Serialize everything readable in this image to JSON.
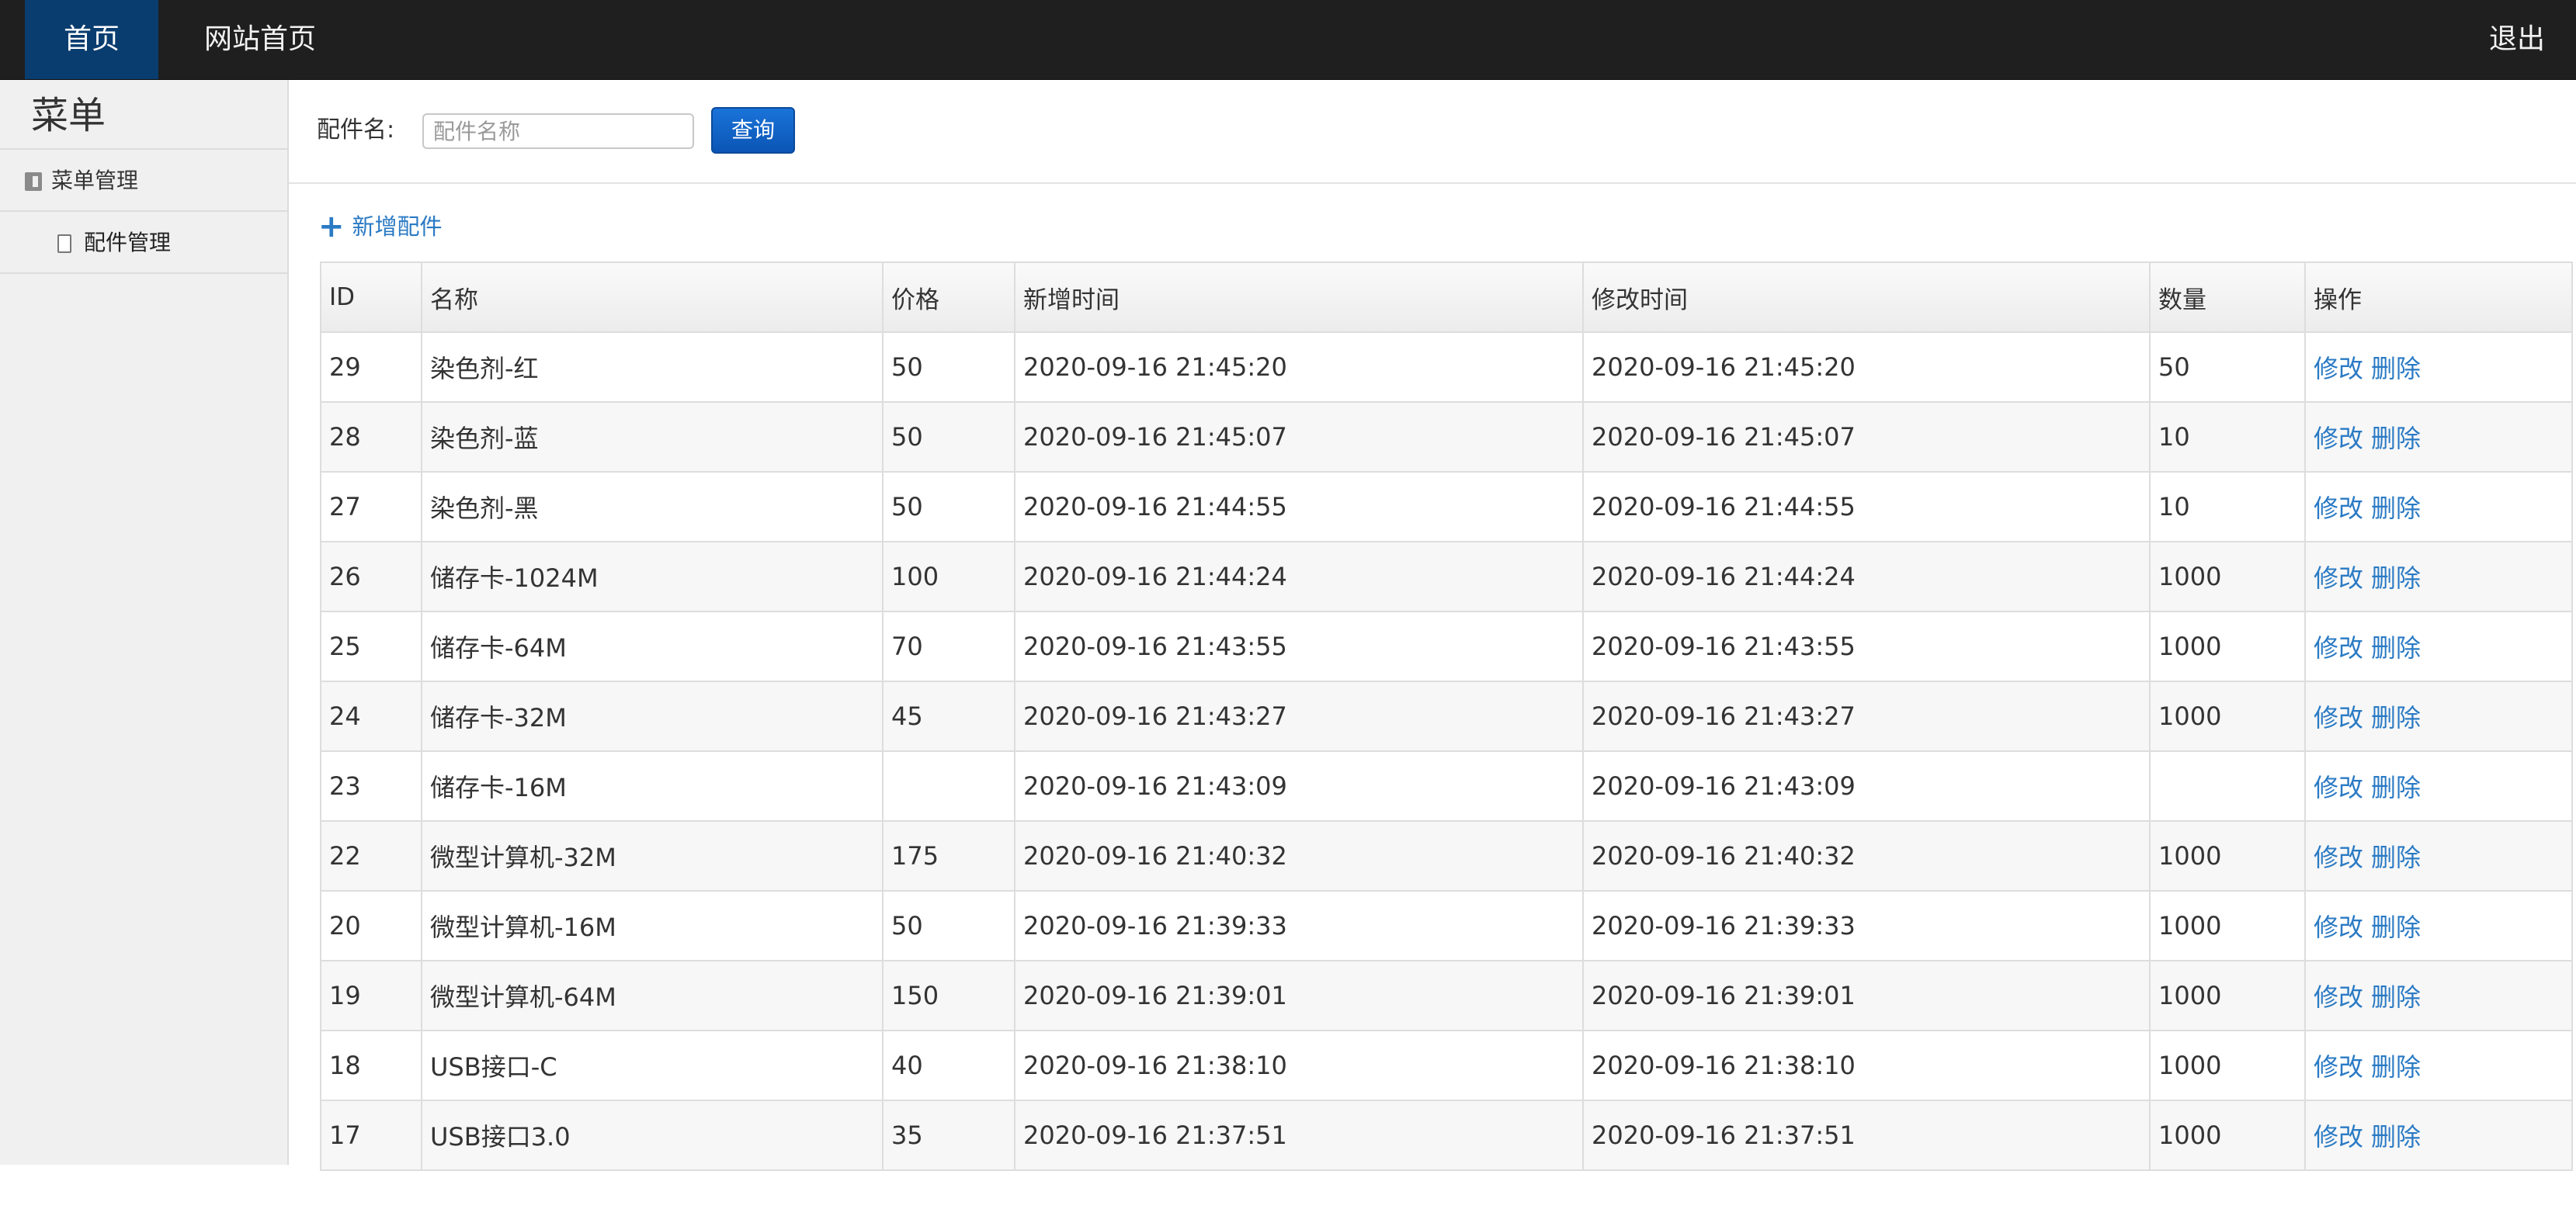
{
  "nav": {
    "home": "首页",
    "site_home": "网站首页",
    "logout": "退出"
  },
  "sidebar": {
    "title": "菜单",
    "group_label": "菜单管理",
    "item_label": "配件管理"
  },
  "search": {
    "label": "配件名:",
    "placeholder": "配件名称",
    "value": "",
    "button": "查询"
  },
  "add_label": "新增配件",
  "table": {
    "headers": [
      "ID",
      "名称",
      "价格",
      "新增时间",
      "修改时间",
      "数量",
      "操作"
    ],
    "action_edit": "修改",
    "action_delete": "删除",
    "rows": [
      {
        "id": "29",
        "name": "染色剂-红",
        "price": "50",
        "created": "2020-09-16 21:45:20",
        "modified": "2020-09-16 21:45:20",
        "qty": "50"
      },
      {
        "id": "28",
        "name": "染色剂-蓝",
        "price": "50",
        "created": "2020-09-16 21:45:07",
        "modified": "2020-09-16 21:45:07",
        "qty": "10"
      },
      {
        "id": "27",
        "name": "染色剂-黑",
        "price": "50",
        "created": "2020-09-16 21:44:55",
        "modified": "2020-09-16 21:44:55",
        "qty": "10"
      },
      {
        "id": "26",
        "name": "储存卡-1024M",
        "price": "100",
        "created": "2020-09-16 21:44:24",
        "modified": "2020-09-16 21:44:24",
        "qty": "1000"
      },
      {
        "id": "25",
        "name": "储存卡-64M",
        "price": "70",
        "created": "2020-09-16 21:43:55",
        "modified": "2020-09-16 21:43:55",
        "qty": "1000"
      },
      {
        "id": "24",
        "name": "储存卡-32M",
        "price": "45",
        "created": "2020-09-16 21:43:27",
        "modified": "2020-09-16 21:43:27",
        "qty": "1000"
      },
      {
        "id": "23",
        "name": "储存卡-16M",
        "price": "",
        "created": "2020-09-16 21:43:09",
        "modified": "2020-09-16 21:43:09",
        "qty": ""
      },
      {
        "id": "22",
        "name": "微型计算机-32M",
        "price": "175",
        "created": "2020-09-16 21:40:32",
        "modified": "2020-09-16 21:40:32",
        "qty": "1000"
      },
      {
        "id": "20",
        "name": "微型计算机-16M",
        "price": "50",
        "created": "2020-09-16 21:39:33",
        "modified": "2020-09-16 21:39:33",
        "qty": "1000"
      },
      {
        "id": "19",
        "name": "微型计算机-64M",
        "price": "150",
        "created": "2020-09-16 21:39:01",
        "modified": "2020-09-16 21:39:01",
        "qty": "1000"
      },
      {
        "id": "18",
        "name": "USB接口-C",
        "price": "40",
        "created": "2020-09-16 21:38:10",
        "modified": "2020-09-16 21:38:10",
        "qty": "1000"
      },
      {
        "id": "17",
        "name": "USB接口3.0",
        "price": "35",
        "created": "2020-09-16 21:37:51",
        "modified": "2020-09-16 21:37:51",
        "qty": "1000"
      }
    ]
  }
}
